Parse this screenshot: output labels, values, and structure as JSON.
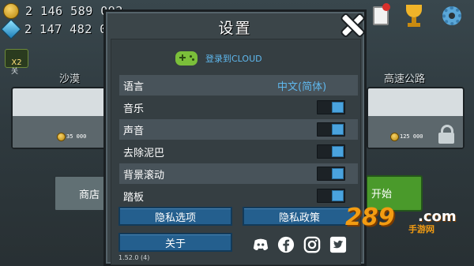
{
  "currency": {
    "coins": "2 146 589 092",
    "gems": "2 147 482 000"
  },
  "badge": {
    "label": "X2",
    "sub": "关"
  },
  "stages": [
    {
      "name": "沙漠",
      "price": "35 000"
    },
    {
      "name": "高速公路",
      "price": "125 000"
    }
  ],
  "buttons": {
    "shop": "商店",
    "start": "开始"
  },
  "dialog": {
    "title": "设置",
    "login_label": "登录到CLOUD",
    "rows": [
      {
        "label": "语言",
        "value": "中文(简体)"
      },
      {
        "label": "音乐",
        "on": true
      },
      {
        "label": "声音",
        "on": true
      },
      {
        "label": "去除泥巴",
        "on": true
      },
      {
        "label": "背景滚动",
        "on": true
      },
      {
        "label": "踏板",
        "on": true
      }
    ],
    "privacy_options": "隐私选项",
    "privacy_policy": "隐私政策",
    "about": "关于",
    "version": "1.52.0 (4)"
  },
  "watermark": {
    "num": "289",
    "com": ".com",
    "sub": "手游网"
  },
  "colors": {
    "accent_blue": "#4aa3de",
    "link_blue": "#5fb8ee",
    "dialog_bg": "#3b4549"
  },
  "icons": [
    "coin-icon",
    "gem-icon",
    "gamepad-icon",
    "close-icon",
    "lock-icon",
    "trophy-icon",
    "gear-icon",
    "clipboard-icon",
    "discord-icon",
    "facebook-icon",
    "instagram-icon",
    "twitter-icon"
  ]
}
